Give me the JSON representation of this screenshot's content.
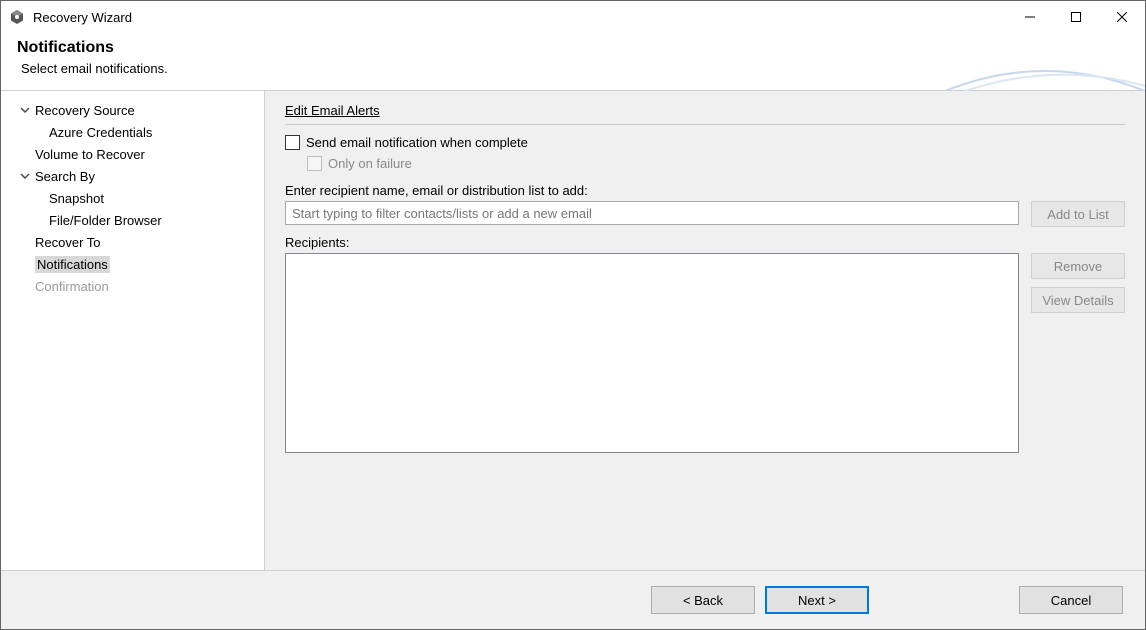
{
  "window": {
    "title": "Recovery Wizard"
  },
  "header": {
    "title": "Notifications",
    "subtitle": "Select email notifications."
  },
  "sidebar": {
    "items": [
      {
        "label": "Recovery Source",
        "chev": "down"
      },
      {
        "label": "Azure Credentials",
        "child": true
      },
      {
        "label": "Volume to Recover"
      },
      {
        "label": "Search By",
        "chev": "down"
      },
      {
        "label": "Snapshot",
        "child": true
      },
      {
        "label": "File/Folder Browser",
        "child": true
      },
      {
        "label": "Recover To"
      },
      {
        "label": "Notifications",
        "selected": true
      },
      {
        "label": "Confirmation",
        "disabled": true
      }
    ]
  },
  "content": {
    "section_title": "Edit Email Alerts",
    "send_checkbox_label": "Send email notification when complete",
    "only_failure_label": "Only on failure",
    "recipient_prompt": "Enter recipient name, email or distribution list to add:",
    "recipient_placeholder": "Start typing to filter contacts/lists or add a new email",
    "add_btn": "Add to List",
    "recipients_label": "Recipients:",
    "remove_btn": "Remove",
    "view_details_btn": "View Details"
  },
  "footer": {
    "back": "< Back",
    "next": "Next >",
    "cancel": "Cancel"
  }
}
